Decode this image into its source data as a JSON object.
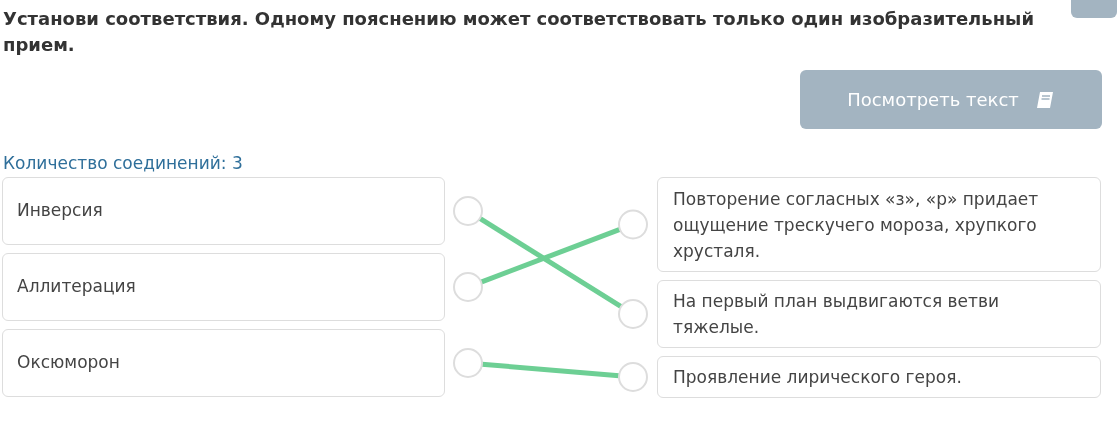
{
  "task": {
    "instruction": "Установи соответствия. Одному пояснению может соответствовать только один изобразительный прием."
  },
  "view_text_button": {
    "label": "Посмотреть текст"
  },
  "connection_count": "Количество соединений: 3",
  "terms": [
    {
      "label": "Инверсия",
      "links": [
        false,
        true,
        false
      ]
    },
    {
      "label": "Аллитерация",
      "links": [
        true,
        false,
        false
      ]
    },
    {
      "label": "Оксюморон",
      "links": [
        false,
        false,
        true
      ]
    }
  ],
  "explanations": [
    {
      "label": "Повторение согласных «з», «р» придает ощущение трескучего мороза, хрупкого хрусталя."
    },
    {
      "label": "На первый план выдвигаются ветви тяжелые."
    },
    {
      "label": "Проявление лирического героя."
    }
  ]
}
